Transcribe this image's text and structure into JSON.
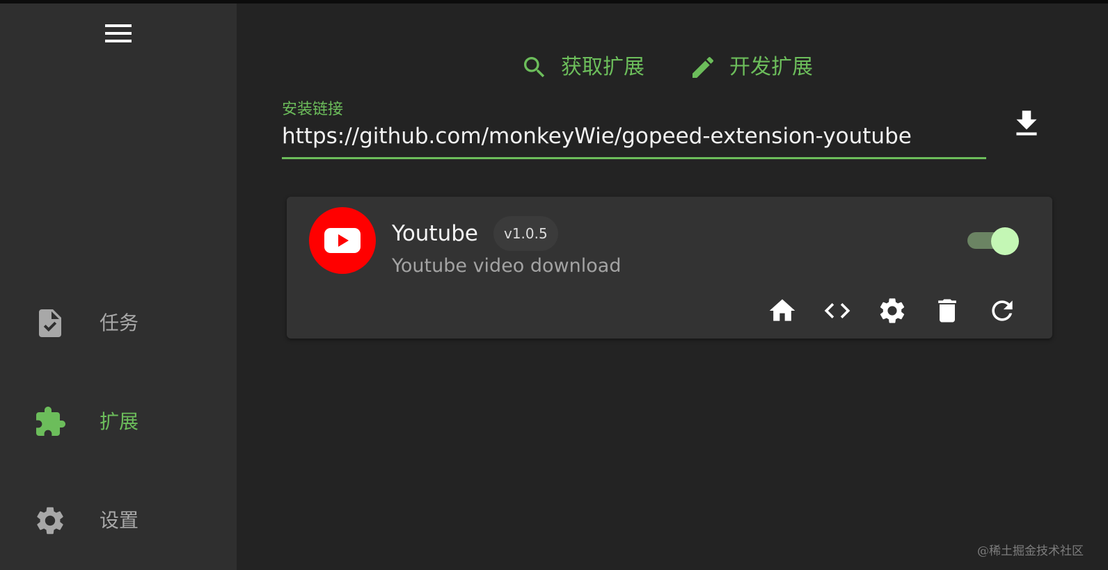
{
  "colors": {
    "accent": "#6cbd5b",
    "sidebar_bg": "#2f2f2f",
    "main_bg": "#232323",
    "card_bg": "#333333",
    "youtube_red": "#ff0000",
    "toggle_thumb": "#c4f7b5"
  },
  "sidebar": {
    "menu_icon": "menu-icon",
    "items": [
      {
        "label": "任务",
        "icon": "task-icon",
        "active": false
      },
      {
        "label": "扩展",
        "icon": "puzzle-icon",
        "active": true
      },
      {
        "label": "设置",
        "icon": "gear-icon",
        "active": false
      }
    ]
  },
  "tabs": [
    {
      "label": "获取扩展",
      "icon": "search-icon"
    },
    {
      "label": "开发扩展",
      "icon": "pencil-icon"
    }
  ],
  "install": {
    "label": "安装链接",
    "value": "https://github.com/monkeyWie/gopeed-extension-youtube",
    "download_icon": "download-icon"
  },
  "extension": {
    "name": "Youtube",
    "version": "v1.0.5",
    "description": "Youtube video download",
    "logo": "youtube-logo",
    "enabled": true,
    "actions": [
      "home-icon",
      "code-icon",
      "gear-icon",
      "trash-icon",
      "refresh-icon"
    ]
  },
  "watermark": "@稀土掘金技术社区"
}
